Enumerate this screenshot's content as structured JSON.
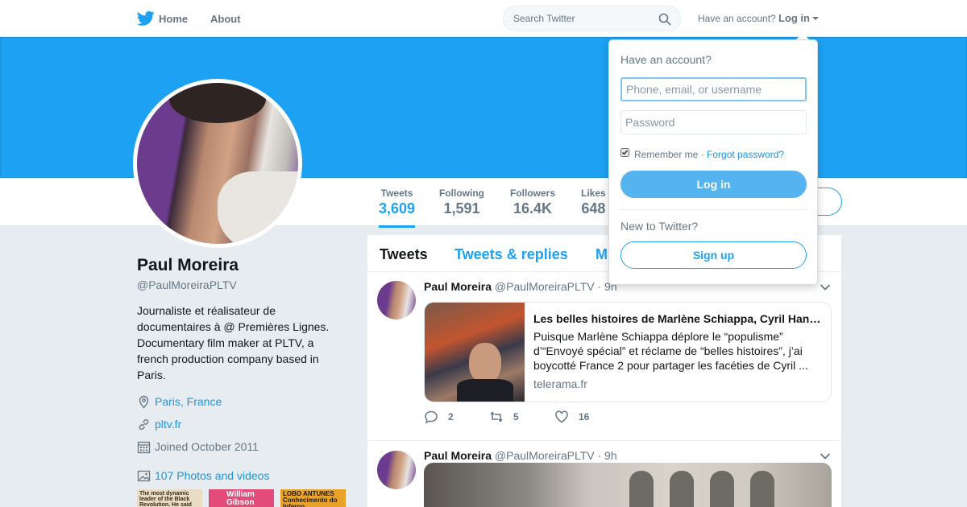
{
  "nav": {
    "home_label": "Home",
    "about_label": "About",
    "search_placeholder": "Search Twitter",
    "have_account": "Have an account?",
    "login_label": "Log in"
  },
  "stats": [
    {
      "label": "Tweets",
      "value": "3,609"
    },
    {
      "label": "Following",
      "value": "1,591"
    },
    {
      "label": "Followers",
      "value": "16.4K"
    },
    {
      "label": "Likes",
      "value": "648"
    }
  ],
  "profile": {
    "name": "Paul Moreira",
    "handle": "@PaulMoreiraPLTV",
    "bio": "Journaliste et réalisateur de documentaires à @ Premières Lignes. Documentary film maker at PLTV, a french production company based in Paris.",
    "location": "Paris, France",
    "url": "pltv.fr",
    "joined": "Joined October 2011",
    "photos": "107 Photos and videos"
  },
  "thumbs": [
    {
      "text": "The most dynamic leader of the Black Revolution. He said he would be murdered before this book appeared.",
      "bg": "#e8dcc4",
      "fg": "#3a2a1a"
    },
    {
      "text": "William Gibson",
      "bg": "#e24b7a",
      "fg": "#ffffff"
    },
    {
      "text": "LOBO ANTUNES Conhecimento do Inferno",
      "bg": "#e8a22a",
      "fg": "#1a1a1a"
    }
  ],
  "tabs": [
    "Tweets",
    "Tweets & replies",
    "M"
  ],
  "tweets": [
    {
      "author": "Paul Moreira",
      "handle": "@PaulMoreiraPLTV",
      "time": "· 9h",
      "card_title": "Les belles histoires de Marlène Schiappa, Cyril Han…",
      "card_desc": "Puisque Marlène Schiappa déplore le “populisme” d’“Envoyé spécial” et réclame de “belles histoires”, j’ai boycotté France 2 pour partager les facéties de Cyril ...",
      "card_domain": "telerama.fr",
      "replies": "2",
      "retweets": "5",
      "likes": "16"
    },
    {
      "author": "Paul Moreira",
      "handle": "@PaulMoreiraPLTV",
      "time": "· 9h"
    }
  ],
  "login_dropdown": {
    "title": "Have an account?",
    "username_placeholder": "Phone, email, or username",
    "password_placeholder": "Password",
    "remember": "Remember me",
    "separator": " · ",
    "forgot": "Forgot password?",
    "login_button": "Log in",
    "new_to": "New to Twitter?",
    "signup_button": "Sign up"
  },
  "colors": {
    "brand": "#1da1f2",
    "banner": "#1da1f2",
    "link": "#1b95e0"
  }
}
